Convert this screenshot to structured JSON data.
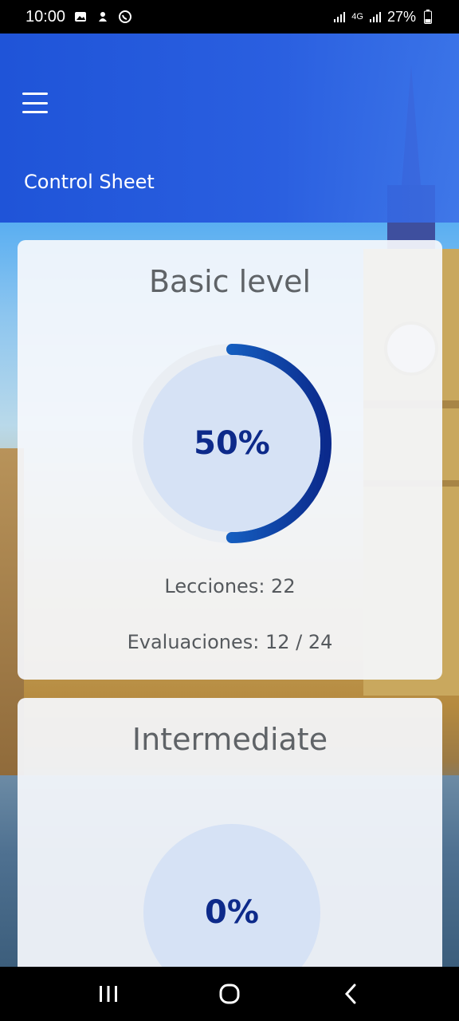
{
  "status_bar": {
    "time": "10:00",
    "battery": "27%",
    "network": "4G"
  },
  "header": {
    "title": "Control Sheet",
    "menu_icon": "hamburger-menu-icon"
  },
  "levels": [
    {
      "title": "Basic level",
      "progress_label": "50%",
      "progress": 0.5,
      "lessons": "Lecciones: 22",
      "evaluations": "Evaluaciones: 12 / 24"
    },
    {
      "title": "Intermediate",
      "progress_label": "0%",
      "progress": 0.0
    }
  ],
  "colors": {
    "header": "#1f54d8",
    "progress_ring_start": "#1e8ff0",
    "progress_ring_end": "#0b2a8c",
    "progress_text": "#0d2a8a",
    "card_title": "#5f6367"
  }
}
